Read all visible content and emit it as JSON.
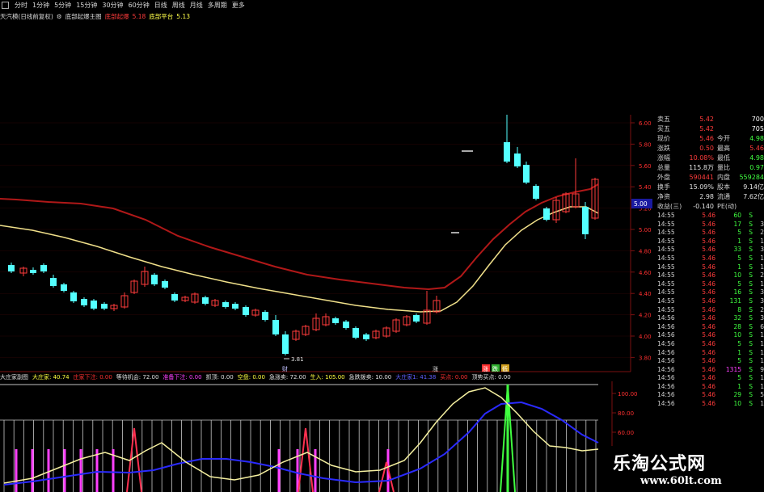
{
  "toolbar": {
    "periods": [
      "分时",
      "1分钟",
      "5分钟",
      "15分钟",
      "30分钟",
      "60分钟",
      "日线",
      "周线",
      "月线",
      "多周期",
      "更多"
    ]
  },
  "main_legend": {
    "stock": "天汽模(日线前复权)",
    "indicator": "底部起爆主图",
    "item1_label": "底部起爆",
    "item1_value": "5.18",
    "item2_label": "底部平台",
    "item2_value": "5.13"
  },
  "price_axis": [
    "6.00",
    "5.80",
    "5.60",
    "5.40",
    "5.20",
    "5.00",
    "4.80",
    "4.60",
    "4.40",
    "4.20",
    "4.00",
    "3.80"
  ],
  "price_marker": "5.00",
  "low_label": "3.81",
  "event_marks": [
    "财",
    "涨",
    "涨",
    "跌",
    "低"
  ],
  "sub_legend": [
    {
      "text": "大庄家副图",
      "color": "#e0e0e0"
    },
    {
      "text": "大庄家: 40.74",
      "color": "#ffff40"
    },
    {
      "text": "庄家下注: 0.00",
      "color": "#ff3030"
    },
    {
      "text": "等待机会: 72.00",
      "color": "#e0e0e0"
    },
    {
      "text": "准备下注: 0.00",
      "color": "#ff40ff"
    },
    {
      "text": "抓顶: 0.00",
      "color": "#e0e0e0"
    },
    {
      "text": "空盘: 0.00",
      "color": "#ffff40"
    },
    {
      "text": "急涨卖: 72.00",
      "color": "#e0e0e0"
    },
    {
      "text": "生入: 105.00",
      "color": "#ffff40"
    },
    {
      "text": "急跌拨卖: 10.00",
      "color": "#e0e0e0"
    },
    {
      "text": "大庄家1: 41.38",
      "color": "#6060ff"
    },
    {
      "text": "买点: 0.00",
      "color": "#ff3030"
    },
    {
      "text": "顶势买点: 0.00",
      "color": "#e0e0e0"
    }
  ],
  "sub_axis": [
    "100.00",
    "80.00",
    "60.00"
  ],
  "quote": {
    "rows": [
      {
        "l1": "卖五",
        "v1": "5.42",
        "c1": "#ff3b3b",
        "l2": "",
        "v2": "700",
        "c2": "#ffffff"
      },
      {
        "l1": "买五",
        "v1": "5.42",
        "c1": "#ff3b3b",
        "l2": "",
        "v2": "705",
        "c2": "#ffffff"
      },
      {
        "l1": "现价",
        "v1": "5.46",
        "c1": "#ff3b3b",
        "l2": "今开",
        "v2": "4.98",
        "c2": "#40ff40"
      },
      {
        "l1": "涨跌",
        "v1": "0.50",
        "c1": "#ff3b3b",
        "l2": "最高",
        "v2": "5.46",
        "c2": "#ff3b3b"
      },
      {
        "l1": "涨幅",
        "v1": "10.08%",
        "c1": "#ff3b3b",
        "l2": "最低",
        "v2": "4.98",
        "c2": "#40ff40"
      },
      {
        "l1": "总量",
        "v1": "115.8万",
        "c1": "#e0e0e0",
        "l2": "量比",
        "v2": "0.97",
        "c2": "#40ff40"
      },
      {
        "l1": "外盘",
        "v1": "590441",
        "c1": "#ff3b3b",
        "l2": "内盘",
        "v2": "559284",
        "c2": "#40ff40"
      },
      {
        "l1": "换手",
        "v1": "15.09%",
        "c1": "#e0e0e0",
        "l2": "股本",
        "v2": "9.14亿",
        "c2": "#e0e0e0"
      },
      {
        "l1": "净资",
        "v1": "2.98",
        "c1": "#e0e0e0",
        "l2": "流通",
        "v2": "7.62亿",
        "c2": "#e0e0e0"
      },
      {
        "l1": "收益(三)",
        "v1": "-0.140",
        "c1": "#e0e0e0",
        "l2": "PE(动)",
        "v2": "",
        "c2": "#e0e0e0"
      }
    ]
  },
  "ticks": [
    {
      "time": "14:55",
      "price": "5.46",
      "vol": "60",
      "bs": "S",
      "n": ""
    },
    {
      "time": "14:55",
      "price": "5.46",
      "vol": "17",
      "bs": "S",
      "n": "3"
    },
    {
      "time": "14:55",
      "price": "5.46",
      "vol": "5",
      "bs": "S",
      "n": "2"
    },
    {
      "time": "14:55",
      "price": "5.46",
      "vol": "1",
      "bs": "S",
      "n": "1"
    },
    {
      "time": "14:55",
      "price": "5.46",
      "vol": "33",
      "bs": "S",
      "n": "3"
    },
    {
      "time": "14:55",
      "price": "5.46",
      "vol": "5",
      "bs": "S",
      "n": "1"
    },
    {
      "time": "14:55",
      "price": "5.46",
      "vol": "1",
      "bs": "S",
      "n": "1"
    },
    {
      "time": "14:55",
      "price": "5.46",
      "vol": "10",
      "bs": "S",
      "n": "2"
    },
    {
      "time": "14:55",
      "price": "5.46",
      "vol": "5",
      "bs": "S",
      "n": "1"
    },
    {
      "time": "14:55",
      "price": "5.46",
      "vol": "16",
      "bs": "S",
      "n": "3"
    },
    {
      "time": "14:55",
      "price": "5.46",
      "vol": "131",
      "bs": "S",
      "n": "3"
    },
    {
      "time": "14:55",
      "price": "5.46",
      "vol": "8",
      "bs": "S",
      "n": "2"
    },
    {
      "time": "14:56",
      "price": "5.46",
      "vol": "32",
      "bs": "S",
      "n": "3"
    },
    {
      "time": "14:56",
      "price": "5.46",
      "vol": "28",
      "bs": "S",
      "n": "6"
    },
    {
      "time": "14:56",
      "price": "5.46",
      "vol": "10",
      "bs": "S",
      "n": "1"
    },
    {
      "time": "14:56",
      "price": "5.46",
      "vol": "5",
      "bs": "S",
      "n": "1"
    },
    {
      "time": "14:56",
      "price": "5.46",
      "vol": "1",
      "bs": "S",
      "n": "1"
    },
    {
      "time": "14:56",
      "price": "5.46",
      "vol": "5",
      "bs": "S",
      "n": "1"
    },
    {
      "time": "14:56",
      "price": "5.46",
      "vol": "1315",
      "bs": "S",
      "n": "9"
    },
    {
      "time": "14:56",
      "price": "5.46",
      "vol": "5",
      "bs": "S",
      "n": "1"
    },
    {
      "time": "14:56",
      "price": "5.46",
      "vol": "1",
      "bs": "S",
      "n": "1"
    },
    {
      "time": "14:56",
      "price": "5.46",
      "vol": "29",
      "bs": "S",
      "n": "5"
    },
    {
      "time": "14:56",
      "price": "5.46",
      "vol": "10",
      "bs": "S",
      "n": "1"
    }
  ],
  "watermark": {
    "name": "乐淘公式网",
    "url": "www.60lt.com"
  },
  "colors": {
    "up": "#ff3b3b",
    "down": "#54ffff",
    "ma_red": "#b01818",
    "ma_yellow": "#f0e08a",
    "grid_red": "#7a1010"
  }
}
